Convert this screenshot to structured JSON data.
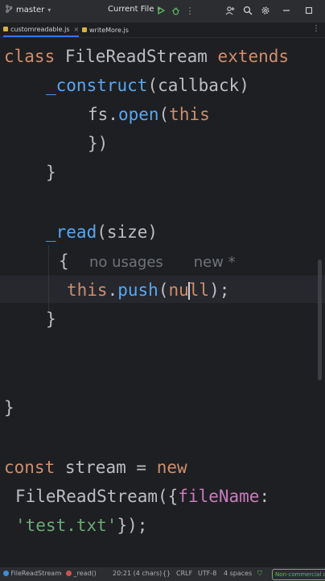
{
  "titlebar": {
    "branch": "master",
    "run_config": "Current File",
    "icons": [
      "git-branch-icon",
      "run-icon",
      "debug-icon",
      "more-icon",
      "add-user-icon",
      "search-icon",
      "settings-icon",
      "minimize-icon",
      "maximize-icon"
    ]
  },
  "tabs": [
    {
      "label": "customreadable.js",
      "active": true
    },
    {
      "label": "writeMore.js",
      "active": false
    }
  ],
  "tabs_more": "⋮",
  "code": {
    "l1_kw1": "class",
    "l1_name": "FileReadStream",
    "l1_kw2": "extends",
    "l2_fn": "_construct",
    "l2_rest": "(callback)",
    "l3_obj": "fs.",
    "l3_fn": "open",
    "l3_p": "(",
    "l3_kw": "this",
    "l4": "})",
    "l5": "}",
    "l6_fn": "_read",
    "l6_rest": "(size)",
    "l7_brace": "{",
    "l7_hint1": "no usages",
    "l7_hint2": "new *",
    "l8_kw": "this",
    "l8_dot": ".",
    "l8_fn": "push",
    "l8_p": "(",
    "l8_nu": "nu",
    "l8_ll": "ll",
    "l8_end": ");",
    "l9": "}",
    "l10": "}",
    "l11_kw1": "const",
    "l11_mid": "stream =",
    "l11_kw2": "new",
    "l12_pre": "FileReadStream({",
    "l12_prop": "fileName",
    "l12_colon": ":",
    "l13_str": "'test.txt'",
    "l13_end": "});"
  },
  "status": {
    "path1": "FileReadStream",
    "path2": "_read()",
    "position": "20:21 (4 chars)",
    "braces": "{}",
    "line_ending": "CRLF",
    "encoding": "UTF-8",
    "indent": "4 spaces",
    "license": "Non-commercial use"
  },
  "colors": {
    "background": "#1e1f22",
    "keyword": "#cf8e6d",
    "function": "#56a8f5",
    "property": "#c77dbb",
    "string": "#6aab73",
    "accent": "#3574f0"
  }
}
